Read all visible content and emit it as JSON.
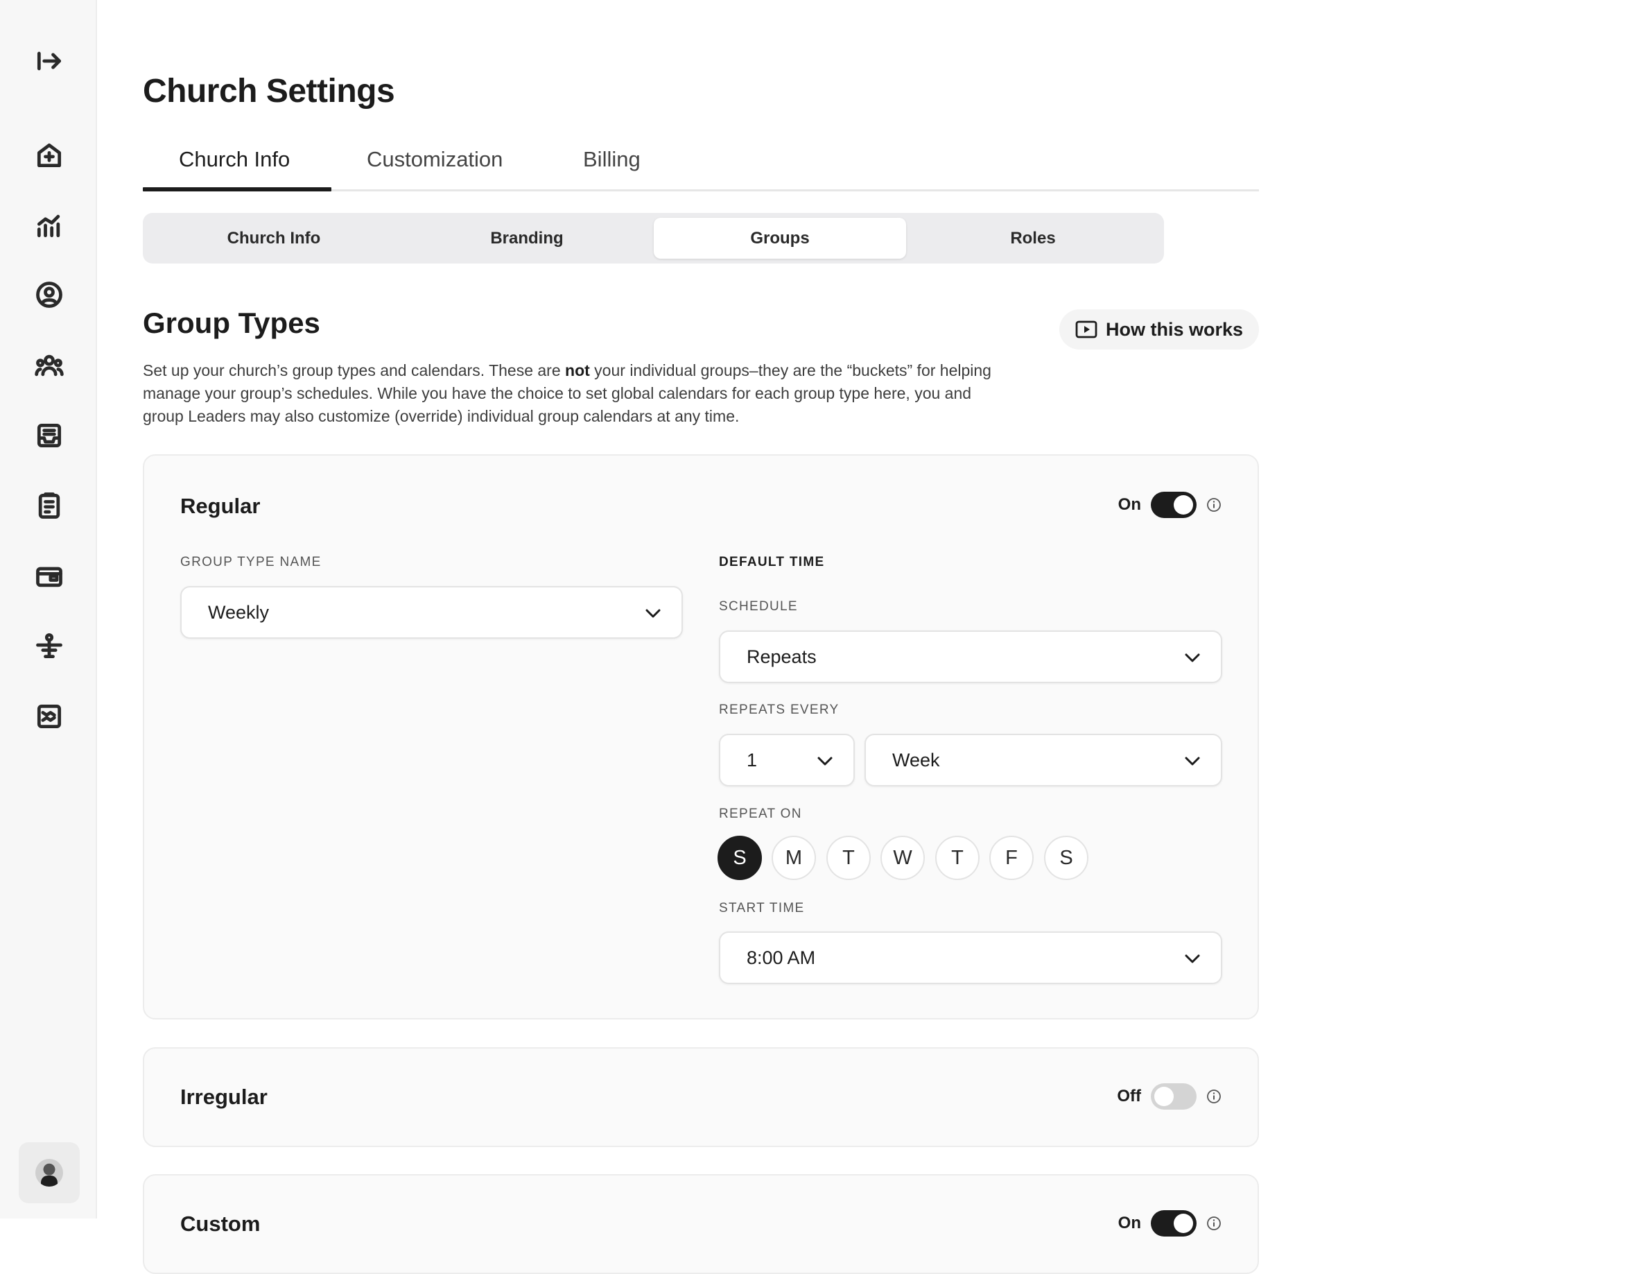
{
  "page": {
    "title": "Church Settings"
  },
  "tabs": [
    {
      "label": "Church Info",
      "active": true
    },
    {
      "label": "Customization",
      "active": false
    },
    {
      "label": "Billing",
      "active": false
    }
  ],
  "subtabs": [
    {
      "label": "Church Info",
      "active": false
    },
    {
      "label": "Branding",
      "active": false
    },
    {
      "label": "Groups",
      "active": true
    },
    {
      "label": "Roles",
      "active": false
    }
  ],
  "section": {
    "title": "Group Types",
    "how_label": "How this works",
    "desc_before": "Set up your church’s group types and calendars. These are ",
    "desc_bold": "not",
    "desc_after": " your individual groups–they are the “buckets” for helping manage your group’s schedules. While you have the choice to set global calendars for each group type here, you and group Leaders may also customize (override) individual group calendars at any time."
  },
  "regular": {
    "title": "Regular",
    "toggle_label": "On",
    "group_type_label": "GROUP TYPE NAME",
    "group_type_value": "Weekly",
    "default_time_label": "DEFAULT TIME",
    "schedule_label": "SCHEDULE",
    "schedule_value": "Repeats",
    "repeats_every_label": "REPEATS EVERY",
    "repeats_count": "1",
    "repeats_unit": "Week",
    "repeat_on_label": "REPEAT ON",
    "days": [
      "S",
      "M",
      "T",
      "W",
      "T",
      "F",
      "S"
    ],
    "selected_day_index": 0,
    "start_time_label": "START TIME",
    "start_time_value": "8:00 AM"
  },
  "irregular": {
    "title": "Irregular",
    "toggle_label": "Off"
  },
  "custom": {
    "title": "Custom",
    "toggle_label": "On"
  },
  "colors": {
    "accent": "#1c1c1c",
    "sidebar_bg": "#f7f7f7",
    "card_bg": "#fafafa"
  }
}
